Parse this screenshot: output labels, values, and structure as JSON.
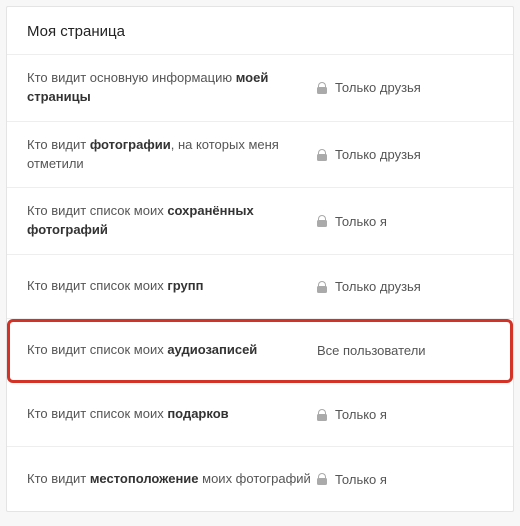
{
  "header": {
    "title": "Моя страница"
  },
  "rows": [
    {
      "label_pre": "Кто видит основную информацию ",
      "label_bold": "моей страницы",
      "label_post": "",
      "value": "Только друзья",
      "locked": true,
      "highlighted": false
    },
    {
      "label_pre": "Кто видит ",
      "label_bold": "фотографии",
      "label_post": ", на которых меня отметили",
      "value": "Только друзья",
      "locked": true,
      "highlighted": false
    },
    {
      "label_pre": "Кто видит список моих ",
      "label_bold": "сохранённых фотографий",
      "label_post": "",
      "value": "Только я",
      "locked": true,
      "highlighted": false
    },
    {
      "label_pre": "Кто видит список моих ",
      "label_bold": "групп",
      "label_post": "",
      "value": "Только друзья",
      "locked": true,
      "highlighted": false
    },
    {
      "label_pre": "Кто видит список моих ",
      "label_bold": "аудиозаписей",
      "label_post": "",
      "value": "Все пользователи",
      "locked": false,
      "highlighted": true
    },
    {
      "label_pre": "Кто видит список моих ",
      "label_bold": "подарков",
      "label_post": "",
      "value": "Только я",
      "locked": true,
      "highlighted": false
    },
    {
      "label_pre": "Кто видит ",
      "label_bold": "местоположение",
      "label_post": " моих фотографий",
      "value": "Только я",
      "locked": true,
      "highlighted": false
    }
  ]
}
